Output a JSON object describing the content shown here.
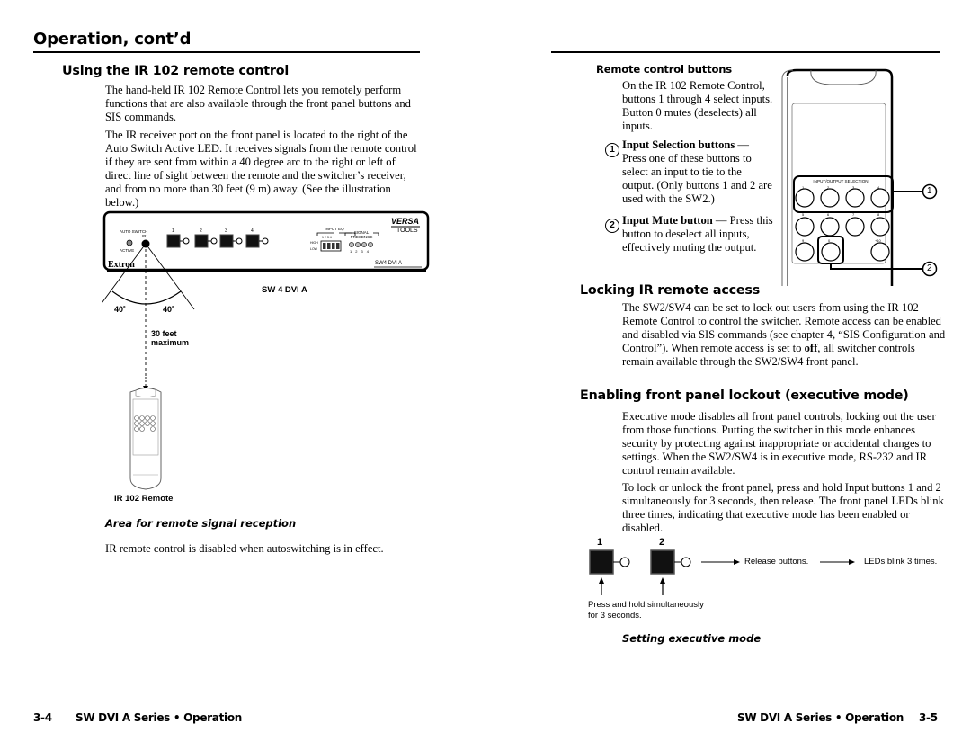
{
  "left_page": {
    "page_title": "Operation, cont’d",
    "section_title": "Using the IR 102 remote control",
    "paragraphs": [
      "The hand-held IR 102 Remote Control lets you remotely perform functions that are also available through the front panel buttons and SIS commands.",
      "The IR receiver port on the front panel is located to the right of the Auto Switch Active LED.  It receives signals from the remote control if they are sent from within a 40 degree arc to the right or left of direct line of sight between the remote and the switcher’s receiver, and from no more than 30 feet (9 m) away. (See the illustration below.)"
    ],
    "figure": {
      "front_panel": {
        "auto_switch_label": "AUTO SWITCH",
        "active_label": "ACTIVE",
        "ir_label": "IR",
        "input_buttons": [
          "1",
          "2",
          "3",
          "4"
        ],
        "input_eq_label": "INPUT EQ",
        "eq_switch_numbers": "1 2 3 4",
        "high_label": "HIGH",
        "low_label": "LOW",
        "signal_presence_label": "SIGNAL PRESENCE",
        "signal_numbers": [
          "1",
          "2",
          "3",
          "4"
        ],
        "brand_logo": "Extron",
        "versa_label": "VERSA",
        "tools_label": "TOOLS",
        "model_label": "SW4 DVI A"
      },
      "model_caption": "SW 4 DVI A",
      "angle_left": "40˚",
      "angle_right": "40˚",
      "distance_line1": "30 feet",
      "distance_line2": "maximum",
      "remote_label": "IR 102 Remote",
      "caption": "Area for remote signal reception"
    },
    "note": "IR remote control is disabled when autoswitching is in effect.",
    "footer": {
      "page_number": "3-4",
      "title": "SW DVI A Series • Operation"
    }
  },
  "right_page": {
    "remote_buttons": {
      "title": "Remote control buttons",
      "intro": "On the IR 102 Remote Control, buttons 1 through 4 select inputs.  Button 0 mutes (deselects) all inputs.",
      "items": [
        {
          "number": "1",
          "term": "Input Selection buttons",
          "dash": " — ",
          "text": "Press one of these buttons to select an input to tie to the output.  (Only buttons 1 and 2 are used with the SW2.)"
        },
        {
          "number": "2",
          "term": "Input Mute button",
          "dash": " — ",
          "text": "Press this button to deselect all inputs, effectively muting the output."
        }
      ],
      "remote_figure": {
        "group_label": "INPUT/OUTPUT SELECTION",
        "button_rows": [
          [
            "1",
            "2",
            "3",
            "4"
          ],
          [
            "5",
            "6",
            "7",
            "8"
          ],
          [
            "9",
            "0",
            "",
            "+10"
          ]
        ],
        "callouts": [
          "1",
          "2"
        ]
      }
    },
    "locking": {
      "title": "Locking IR remote access",
      "text_before": "The SW2/SW4 can be set to lock out users from using the IR 102 Remote Control to control the switcher.  Remote access can be enabled and disabled via SIS commands (see chapter 4, “SIS Configuration and Control”).  When remote access is set to ",
      "bold_word": "off",
      "text_after": ", all switcher controls remain available through the SW2/SW4 front panel."
    },
    "executive": {
      "title": "Enabling front panel lockout (executive mode)",
      "paragraphs": [
        "Executive mode disables all front panel controls, locking out the user from those functions.  Putting the switcher in this mode enhances security by protecting against inappropriate or accidental changes to settings.  When the SW2/SW4 is in executive mode, RS-232 and IR control remain available.",
        "To lock or unlock the front panel, press and hold Input buttons 1 and 2 simultaneously for 3 seconds, then release.  The front panel LEDs blink three times, indicating that executive mode has been enabled or disabled."
      ],
      "figure": {
        "button_labels": [
          "1",
          "2"
        ],
        "step_release": "Release buttons.",
        "step_blink": "LEDs blink 3 times.",
        "press_note_line1": "Press and hold simultaneously",
        "press_note_line2": "for 3 seconds.",
        "caption": "Setting executive mode"
      }
    },
    "footer": {
      "title": "SW DVI A Series • Operation",
      "page_number": "3-5"
    }
  }
}
